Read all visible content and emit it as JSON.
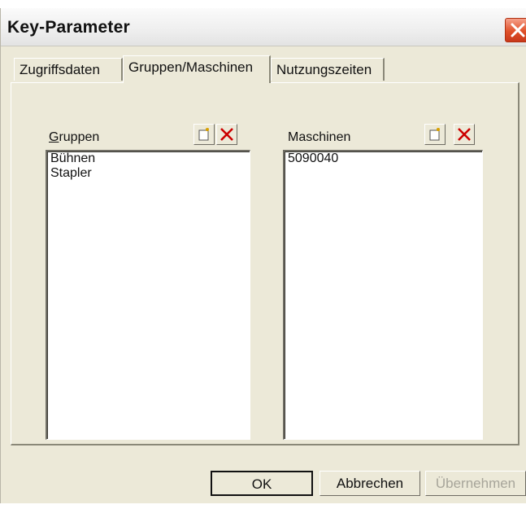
{
  "window": {
    "title": "Key-Parameter"
  },
  "tabs": [
    {
      "label": "Zugriffsdaten",
      "active": false
    },
    {
      "label": "Gruppen/Maschinen",
      "active": true
    },
    {
      "label": "Nutzungszeiten",
      "active": false
    }
  ],
  "groups": {
    "label_accel": "G",
    "label_rest": "ruppen",
    "items": [
      "Bühnen",
      "Stapler"
    ]
  },
  "machines": {
    "label": "Maschinen",
    "items": [
      "5090040"
    ]
  },
  "buttons": {
    "ok": "OK",
    "cancel": "Abbrechen",
    "apply": "Übernehmen"
  },
  "icons": {
    "close": "close-x-icon",
    "new": "new-document-icon",
    "delete": "red-x-delete-icon"
  },
  "colors": {
    "delete_red": "#cc0000",
    "close_button": "#e0512a",
    "dialog_face": "#ece9d8"
  }
}
